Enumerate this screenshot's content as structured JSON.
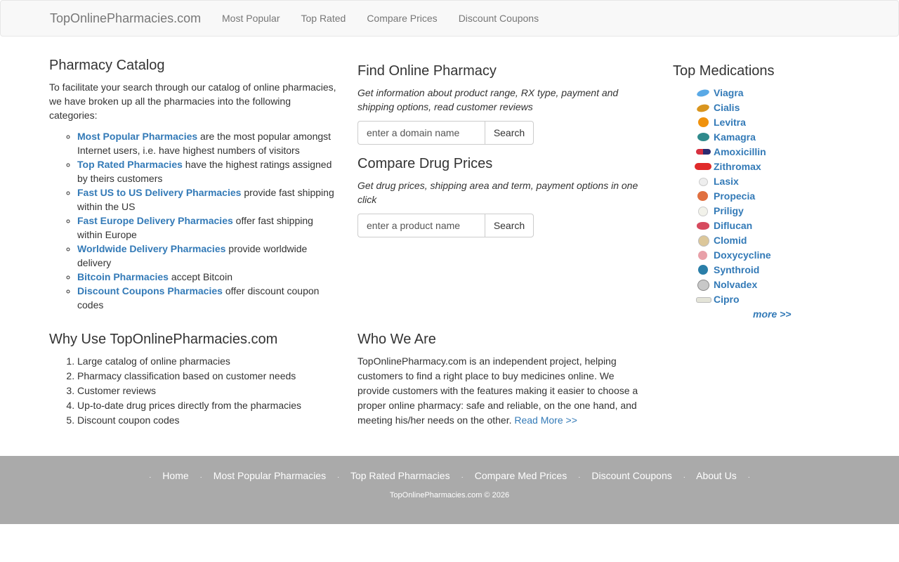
{
  "navbar": {
    "brand": "TopOnlinePharmacies.com",
    "links": [
      "Most Popular",
      "Top Rated",
      "Compare Prices",
      "Discount Coupons"
    ]
  },
  "catalog": {
    "title": "Pharmacy Catalog",
    "intro": "To facilitate your search through our catalog of online pharmacies, we have broken up all the pharmacies into the following categories:",
    "items": [
      {
        "link": "Most Popular Pharmacies",
        "text": " are the most popular amongst Internet users, i.e. have highest numbers of visitors"
      },
      {
        "link": "Top Rated Pharmacies",
        "text": " have the highest ratings assigned by theirs customers"
      },
      {
        "link": "Fast US to US Delivery Pharmacies",
        "text": " provide fast shipping within the US"
      },
      {
        "link": "Fast Europe Delivery Pharmacies",
        "text": " offer fast shipping within Europe"
      },
      {
        "link": "Worldwide Delivery Pharmacies",
        "text": " provide worldwide delivery"
      },
      {
        "link": "Bitcoin Pharmacies",
        "text": " accept Bitcoin"
      },
      {
        "link": "Discount Coupons Pharmacies",
        "text": " offer discount coupon codes"
      }
    ]
  },
  "find": {
    "title": "Find Online Pharmacy",
    "desc": "Get information about product range, RX type, payment and shipping options, read customer reviews",
    "placeholder": "enter a domain name",
    "button": "Search"
  },
  "compare": {
    "title": "Compare Drug Prices",
    "desc": "Get drug prices, shipping area and term, payment options in one click",
    "placeholder": "enter a product name",
    "button": "Search"
  },
  "top_meds": {
    "title": "Top Medications",
    "items": [
      {
        "name": "Viagra",
        "icon": "blue-pill-icon"
      },
      {
        "name": "Cialis",
        "icon": "yellow-pill-icon"
      },
      {
        "name": "Levitra",
        "icon": "orange-pill-icon"
      },
      {
        "name": "Kamagra",
        "icon": "teal-pill-icon"
      },
      {
        "name": "Amoxicillin",
        "icon": "capsule-icon"
      },
      {
        "name": "Zithromax",
        "icon": "red-pill-icon"
      },
      {
        "name": "Lasix",
        "icon": "white-pill-icon"
      },
      {
        "name": "Propecia",
        "icon": "salmon-pill-icon"
      },
      {
        "name": "Priligy",
        "icon": "white-pill-icon"
      },
      {
        "name": "Diflucan",
        "icon": "pink-pill-icon"
      },
      {
        "name": "Clomid",
        "icon": "beige-pill-icon"
      },
      {
        "name": "Doxycycline",
        "icon": "pink-pill-icon"
      },
      {
        "name": "Synthroid",
        "icon": "teal-pill-icon"
      },
      {
        "name": "Nolvadex",
        "icon": "grey-pill-icon"
      },
      {
        "name": "Cipro",
        "icon": "white-oblong-pill-icon"
      }
    ],
    "more": "more >>"
  },
  "why": {
    "title": "Why Use TopOnlinePharmacies.com",
    "items": [
      "Large catalog of online pharmacies",
      "Pharmacy classification based on customer needs",
      "Customer reviews",
      "Up-to-date drug prices directly from the pharmacies",
      "Discount coupon codes"
    ]
  },
  "who": {
    "title": "Who We Are",
    "text": "TopOnlinePharmacy.com is an independent project, helping customers to find a right place to buy medicines online. We provide customers with the features making it easier to choose a proper online pharmacy: safe and reliable, on the one hand, and meeting his/her needs on the other. ",
    "read_more": "Read More >>"
  },
  "footer": {
    "links": [
      "Home",
      "Most Popular Pharmacies",
      "Top Rated Pharmacies",
      "Compare Med Prices",
      "Discount Coupons",
      "About Us"
    ],
    "separator": "·",
    "copyright": "TopOnlinePharmacies.com © 2026"
  }
}
